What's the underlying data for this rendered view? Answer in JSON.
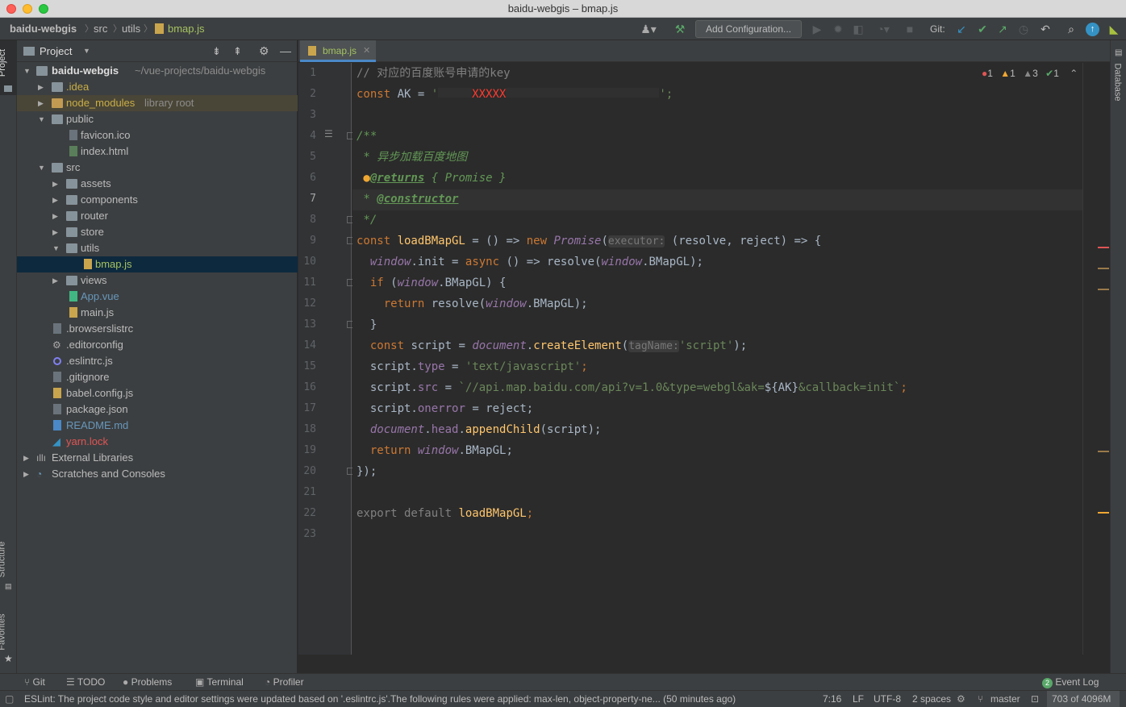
{
  "window": {
    "title": "baidu-webgis – bmap.js"
  },
  "breadcrumb": [
    "baidu-webgis",
    "src",
    "utils",
    "bmap.js"
  ],
  "toolbar": {
    "add_config": "Add Configuration...",
    "git_label": "Git:"
  },
  "sidebar_tabs": {
    "project": "Project",
    "structure": "Structure",
    "favorites": "Favorites",
    "database": "Database"
  },
  "project": {
    "title": "Project",
    "root_name": "baidu-webgis",
    "root_path": "~/vue-projects/baidu-webgis",
    "items": [
      {
        "label": ".idea",
        "extra": ""
      },
      {
        "label": "node_modules",
        "extra": "library root"
      },
      {
        "label": "public",
        "extra": ""
      },
      {
        "label": "favicon.ico",
        "extra": ""
      },
      {
        "label": "index.html",
        "extra": ""
      },
      {
        "label": "src",
        "extra": ""
      },
      {
        "label": "assets",
        "extra": ""
      },
      {
        "label": "components",
        "extra": ""
      },
      {
        "label": "router",
        "extra": ""
      },
      {
        "label": "store",
        "extra": ""
      },
      {
        "label": "utils",
        "extra": ""
      },
      {
        "label": "bmap.js",
        "extra": ""
      },
      {
        "label": "views",
        "extra": ""
      },
      {
        "label": "App.vue",
        "extra": ""
      },
      {
        "label": "main.js",
        "extra": ""
      },
      {
        "label": ".browserslistrc",
        "extra": ""
      },
      {
        "label": ".editorconfig",
        "extra": ""
      },
      {
        "label": ".eslintrc.js",
        "extra": ""
      },
      {
        "label": ".gitignore",
        "extra": ""
      },
      {
        "label": "babel.config.js",
        "extra": ""
      },
      {
        "label": "package.json",
        "extra": ""
      },
      {
        "label": "README.md",
        "extra": ""
      },
      {
        "label": "yarn.lock",
        "extra": ""
      },
      {
        "label": "External Libraries",
        "extra": ""
      },
      {
        "label": "Scratches and Consoles",
        "extra": ""
      }
    ]
  },
  "editor": {
    "tab": "bmap.js",
    "inspections": {
      "errors": "1",
      "warnings": "1",
      "weak": "3",
      "ok": "1"
    },
    "line_numbers": [
      "1",
      "2",
      "3",
      "4",
      "5",
      "6",
      "7",
      "8",
      "9",
      "10",
      "11",
      "12",
      "13",
      "14",
      "15",
      "16",
      "17",
      "18",
      "19",
      "20",
      "21",
      "22",
      "23"
    ],
    "current_line": "7",
    "tokens": {
      "l1": "// 对应的百度账号申请的key",
      "l2a": "const",
      "l2b": " AK = ",
      "l2c": "'",
      "l2d": "XXXXX",
      "l2e": "';",
      "l4": "/**",
      "l5": " * 异步加载百度地图",
      "l6a": "@returns",
      "l6b": " { Promise }",
      "l7a": " * ",
      "l7b": "@constructor",
      "l8": " */",
      "l9a": "const ",
      "l9b": "loadBMapGL",
      "l9c": " = () => ",
      "l9d": "new ",
      "l9e": "Promise",
      "l9f": "(",
      "l9g": "executor:",
      "l9h": " (resolve, reject) => {",
      "l10a": "window",
      "l10b": ".init",
      "l10c": " = ",
      "l10d": "async",
      "l10e": " () => resolve(",
      "l10f": "window",
      "l10g": ".BMapGL);",
      "l11a": "if",
      "l11b": " (",
      "l11c": "window",
      "l11d": ".BMapGL) {",
      "l12a": "return",
      "l12b": " resolve(",
      "l12c": "window",
      "l12d": ".BMapGL);",
      "l13": "}",
      "l14a": "const",
      "l14b": " script = ",
      "l14c": "document",
      "l14d": ".",
      "l14e": "createElement",
      "l14f": "(",
      "l14g": "tagName:",
      "l14h": "'script'",
      "l14i": ");",
      "l15a": "script.",
      "l15b": "type",
      "l15c": " = ",
      "l15d": "'text/javascript'",
      "l15e": ";",
      "l16a": "script.",
      "l16b": "src",
      "l16c": " = ",
      "l16d": "`//api.map.baidu.com/api?v=1.0&type=webgl&ak=",
      "l16e": "${AK}",
      "l16f": "&callback=init`",
      "l16g": ";",
      "l17a": "script.",
      "l17b": "onerror",
      "l17c": " = reject;",
      "l18a": "document",
      "l18b": ".",
      "l18c": "head",
      "l18d": ".",
      "l18e": "appendChild",
      "l18f": "(script);",
      "l19a": "return ",
      "l19b": "window",
      "l19c": ".BMapGL;",
      "l20": "});",
      "l22a": "export default ",
      "l22b": "loadBMapGL",
      "l22c": ";"
    }
  },
  "bottom_tools": [
    "Git",
    "TODO",
    "Problems",
    "Terminal",
    "Profiler"
  ],
  "event_log": {
    "count": "2",
    "label": "Event Log"
  },
  "status": {
    "message": "ESLint: The project code style and editor settings were updated based on '.eslintrc.js'.The following rules were applied: max-len, object-property-ne... (50 minutes ago)",
    "position": "7:16",
    "line_sep": "LF",
    "encoding": "UTF-8",
    "indent": "2 spaces",
    "branch": "master",
    "memory": "703 of 4096M"
  },
  "colors": {
    "accent": "#4a88c7",
    "error": "#e05555",
    "warning": "#f0a732"
  }
}
